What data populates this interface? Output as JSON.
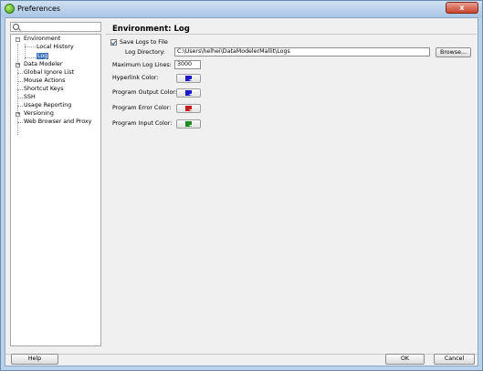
{
  "window": {
    "title": "Preferences",
    "close_label": "x"
  },
  "search": {
    "placeholder": ""
  },
  "tree": {
    "environment": "Environment",
    "local_history": "Local History",
    "log": "Log",
    "data_modeler": "Data Modeler",
    "global_ignore_list": "Global Ignore List",
    "mouse_actions": "Mouse Actions",
    "shortcut_keys": "Shortcut Keys",
    "ssh": "SSH",
    "usage_reporting": "Usage Reporting",
    "versioning": "Versioning",
    "web_browser_and_proxy": "Web Browser and Proxy"
  },
  "page": {
    "title": "Environment: Log"
  },
  "form": {
    "save_logs_label": "Save Logs to File",
    "log_directory_label": "Log Directory:",
    "log_directory_value": "C:\\Users\\helhei\\DataModelerMallit\\Logs",
    "browse_label": "Browse...",
    "max_lines_label": "Maximum Log Lines:",
    "max_lines_value": "3000",
    "hyperlink_label": "Hyperlink Color:",
    "output_label": "Program Output Color:",
    "error_label": "Program Error Color:",
    "input_label": "Program Input Color:"
  },
  "colors": {
    "hyperlink": "#1a1ac8",
    "output": "#1a1ac8",
    "error": "#c81a1a",
    "input": "#1f8a1f"
  },
  "footer": {
    "help_label": "Help",
    "ok_label": "OK",
    "cancel_label": "Cancel"
  }
}
